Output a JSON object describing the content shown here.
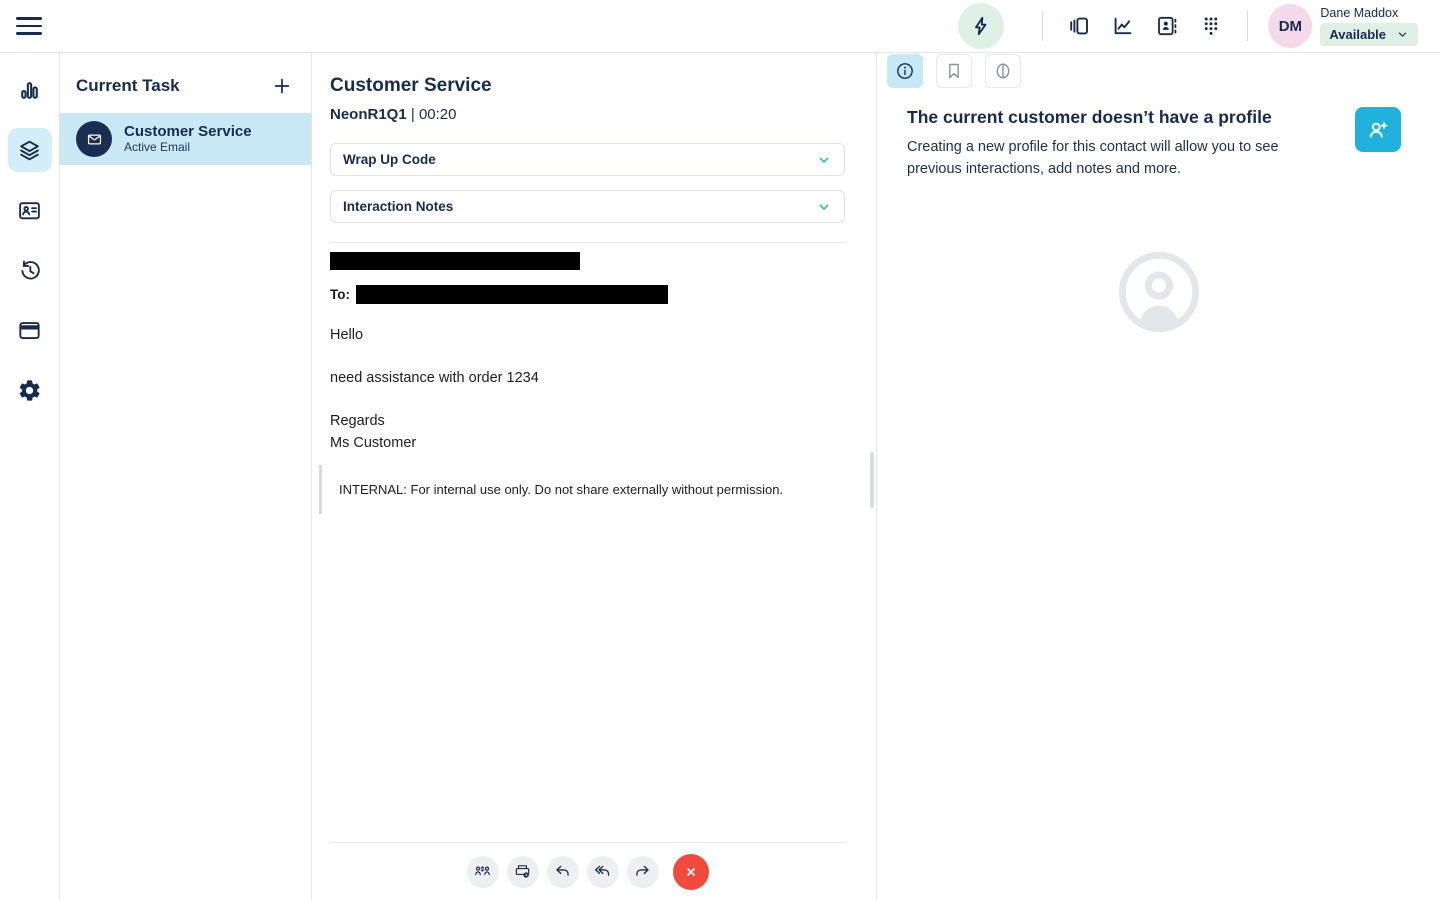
{
  "topbar": {
    "user_name": "Dane Maddox",
    "user_initials": "DM",
    "status_label": "Available",
    "icons": [
      "hamburger-menu-icon",
      "lightning-bolt-icon",
      "panels-icon",
      "line-chart-icon",
      "directory-icon",
      "dialpad-icon",
      "status-chevron-down-icon"
    ]
  },
  "sidebar": {
    "icons": [
      "bar-chart-icon",
      "layers-icon",
      "contact-card-icon",
      "history-icon",
      "window-icon",
      "gear-icon"
    ],
    "active_icon": "layers-icon"
  },
  "task_panel": {
    "title": "Current Task",
    "add_icon": "plus-icon",
    "item": {
      "title": "Customer Service",
      "subtitle": "Active Email",
      "icon": "envelope-icon"
    }
  },
  "interaction": {
    "title": "Customer Service",
    "queue": "NeonR1Q1",
    "separator": "|",
    "timer": "00:20",
    "wrapup_label": "Wrap Up Code",
    "notes_label": "Interaction Notes",
    "email": {
      "to_label": "To:",
      "greeting": "Hello",
      "body": "need assistance with order 1234",
      "signoff": "Regards",
      "signature": "Ms Customer",
      "internal_note": "INTERNAL: For internal use only. Do not share externally without permission."
    },
    "toolbar_icons": [
      "transfer-icon",
      "park-email-icon",
      "reply-icon",
      "reply-all-icon",
      "forward-icon",
      "disconnect-icon"
    ]
  },
  "profile_panel": {
    "tabs": [
      "info-icon",
      "bookmark-icon",
      "journey-icon"
    ],
    "active_tab": "info-icon",
    "heading": "The current customer doesn’t have a profile",
    "description": "Creating a new profile for this contact will allow you to see previous interactions, add notes and more.",
    "add_button_icon": "person-add-icon",
    "placeholder_icon": "person-circle-icon"
  },
  "colors": {
    "navy": "#182b4e",
    "accent_cyan": "#20b2dc",
    "highlight_blue": "#c9e8f6",
    "status_green_bg": "#def0e5",
    "avatar_pink": "#f3d9e9",
    "danger_red": "#f04a3c",
    "placeholder_gray": "#e3e6ea"
  }
}
